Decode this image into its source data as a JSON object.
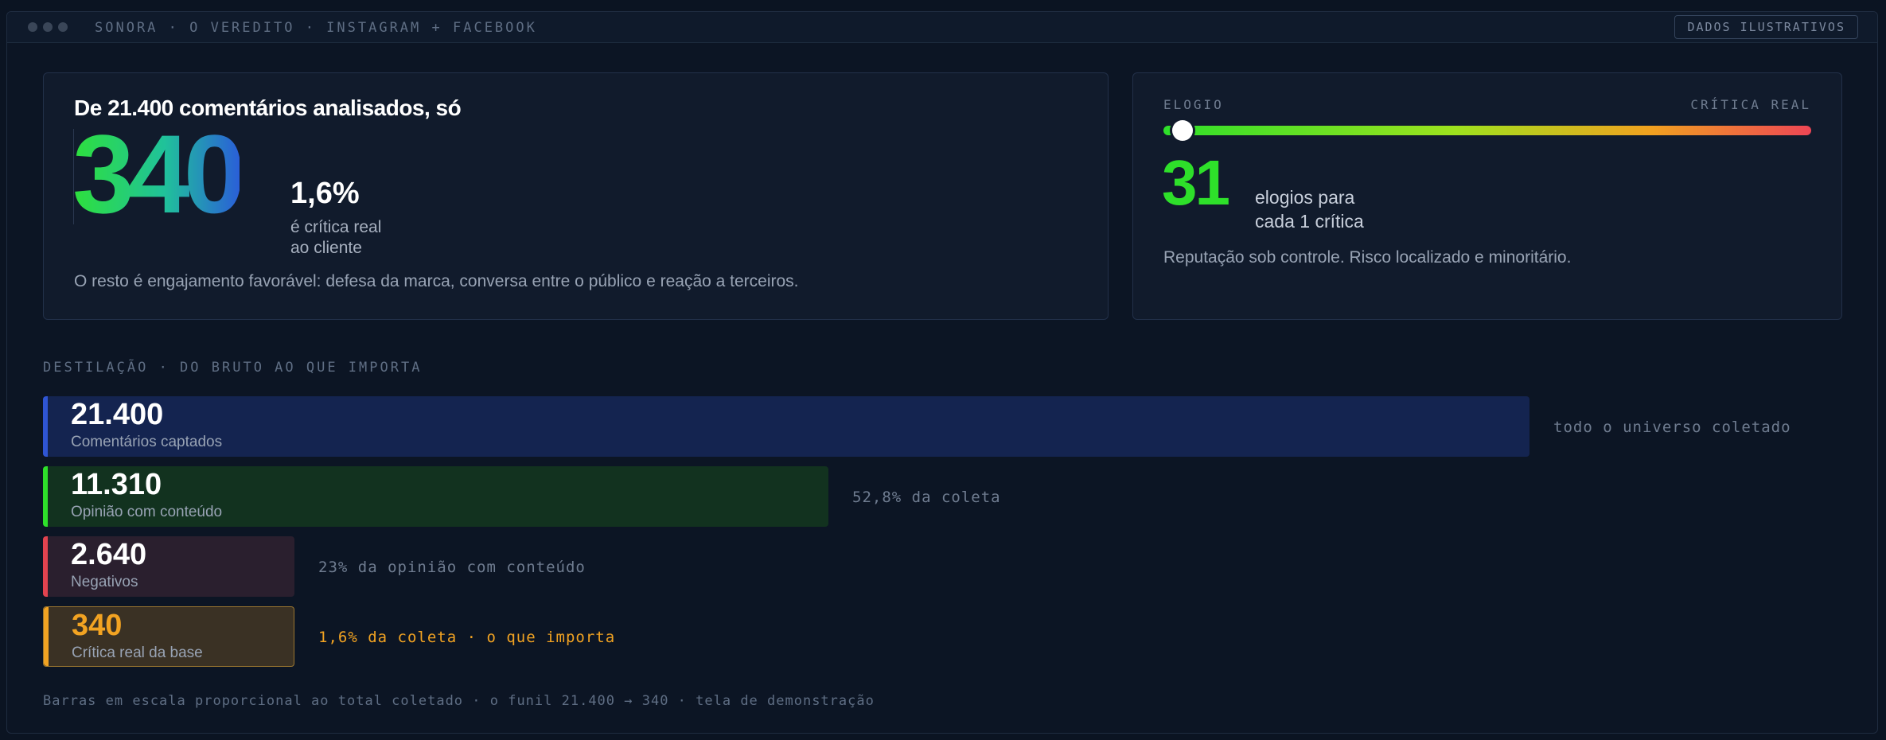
{
  "window": {
    "title": "SONORA · O VEREDITO · INSTAGRAM + FACEBOOK",
    "badge": "DADOS ILUSTRATIVOS"
  },
  "hero": {
    "headline": "De 21.400 comentários analisados, só",
    "big_number": "340",
    "percent": "1,6%",
    "percent_caption_line1": "é crítica real",
    "percent_caption_line2": "ao cliente",
    "footnote": "O resto é engajamento favorável: defesa da marca, conversa entre o público e reação a terceiros."
  },
  "ratio": {
    "left_label": "ELOGIO",
    "right_label": "CRÍTICA REAL",
    "slider_position": 0.03,
    "number": "31",
    "caption_line1": "elogios para",
    "caption_line2": "cada 1 crítica",
    "footnote": "Reputação sob controle. Risco localizado e minoritário."
  },
  "funnel": {
    "section_label": "DESTILAÇÃO · DO BRUTO AO QUE IMPORTA",
    "total": 21400,
    "rows": [
      {
        "value": 21400,
        "value_text": "21.400",
        "label": "Comentários captados",
        "note": "todo o universo coletado",
        "color": "#2f55d4"
      },
      {
        "value": 11310,
        "value_text": "11.310",
        "label": "Opinião com conteúdo",
        "note": "52,8% da coleta",
        "color": "#2ee02a"
      },
      {
        "value": 2640,
        "value_text": "2.640",
        "label": "Negativos",
        "note": "23% da opinião com conteúdo",
        "color": "#e2434f"
      },
      {
        "value": 340,
        "value_text": "340",
        "label": "Crítica real da base",
        "note": "1,6% da coleta · o que importa",
        "color": "#f2a322"
      }
    ],
    "footer": "Barras em escala proporcional ao total coletado · o funil 21.400 → 340 · tela de demonstração"
  }
}
